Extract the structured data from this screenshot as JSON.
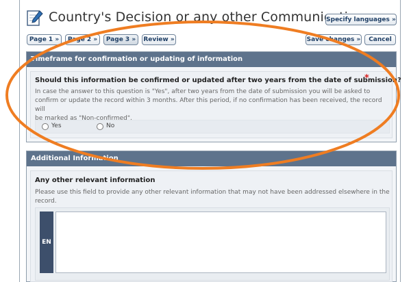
{
  "header": {
    "title": "Country's Decision or any other Communication",
    "specify_languages": "Specify languages »"
  },
  "toolbar": {
    "pages": [
      "Page 1 »",
      "Page 2 »",
      "Page 3 »",
      "Review »"
    ],
    "save_changes": "Save changes »",
    "cancel": "Cancel"
  },
  "timeframe_section": {
    "title": "Timeframe for confirmation or updating of information",
    "question": "Should this information be confirmed or updated after two years from the date of submission?",
    "required_mark": "*",
    "help_lines": [
      "In case the answer to this question is \"Yes\", after two years from the date of submission you will be asked to",
      "confirm or update the record within 3 months. After this period, if no confirmation has been received, the record will",
      "be marked as \"Non-confirmed\"."
    ],
    "options": [
      "Yes",
      "No"
    ]
  },
  "additional_section": {
    "title": "Additional Information",
    "field_label": "Any other relevant information",
    "help_lines": [
      "Please use this field to provide any other relevant information that may not have been addressed elsewhere in the",
      "record."
    ],
    "language_tab": "EN"
  },
  "colors": {
    "section_header": "#5e738c",
    "annotation_ellipse": "#ef7d22",
    "required": "#d71f1f",
    "language_tab": "#3d4f6b"
  }
}
